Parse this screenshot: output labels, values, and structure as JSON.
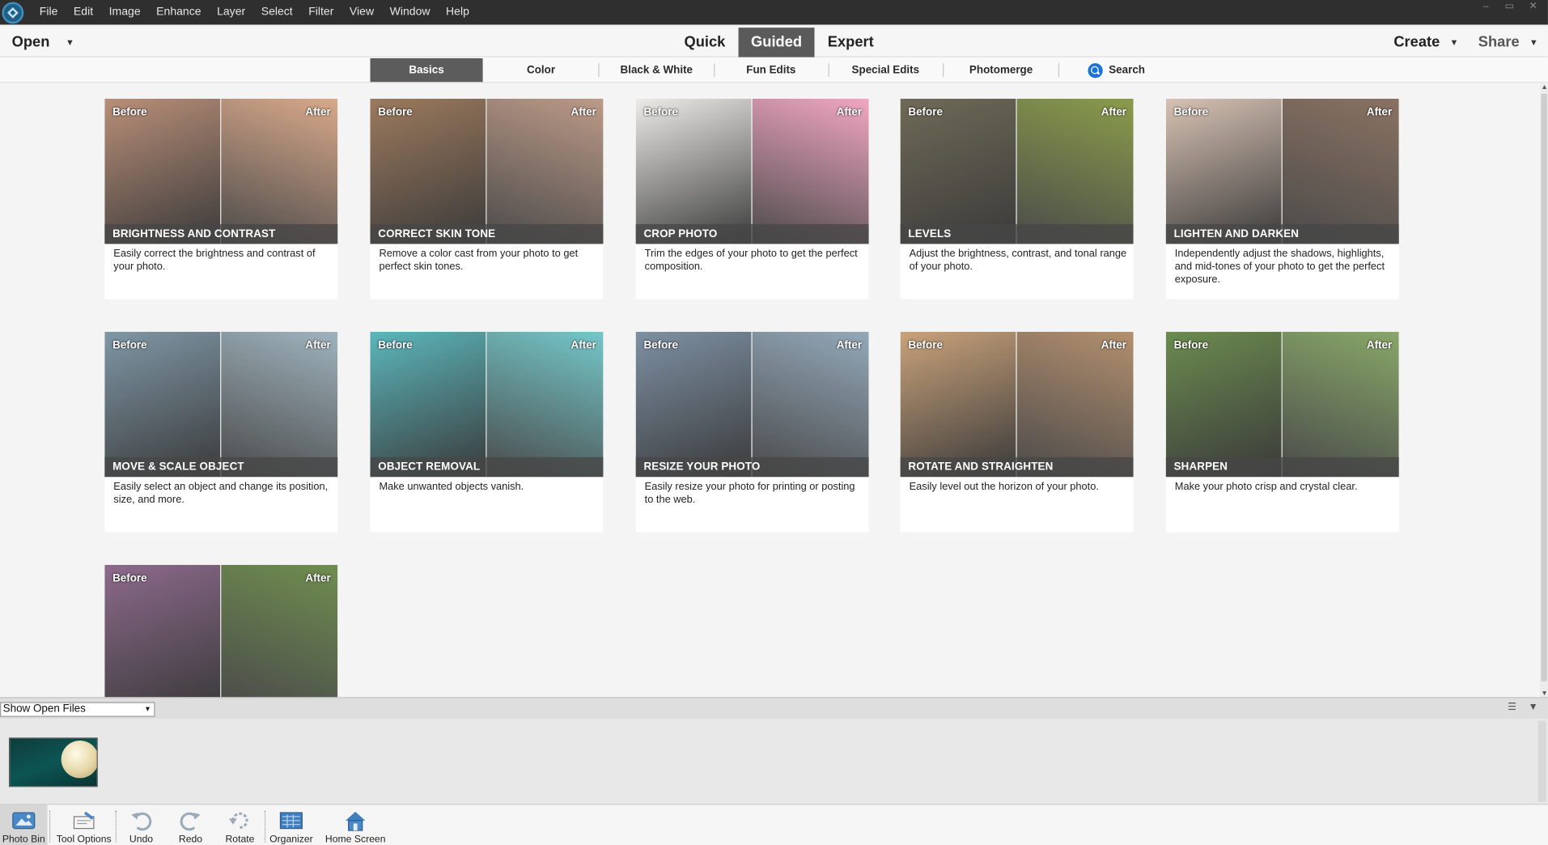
{
  "menubar": {
    "items": [
      "File",
      "Edit",
      "Image",
      "Enhance",
      "Layer",
      "Select",
      "Filter",
      "View",
      "Window",
      "Help"
    ],
    "window_controls": [
      "–",
      "▭",
      "✕"
    ]
  },
  "modebar": {
    "open_label": "Open",
    "modes": [
      "Quick",
      "Guided",
      "Expert"
    ],
    "active_mode": "Guided",
    "create_label": "Create",
    "share_label": "Share"
  },
  "categories": {
    "tabs": [
      "Basics",
      "Color",
      "Black & White",
      "Fun Edits",
      "Special Edits",
      "Photomerge"
    ],
    "active": "Basics",
    "search_label": "Search"
  },
  "cards": [
    {
      "title": "BRIGHTNESS AND CONTRAST",
      "desc": "Easily correct the brightness and contrast of your photo.",
      "before": "Before",
      "after": "After",
      "colors": [
        "#b98f78",
        "#d9a98a"
      ]
    },
    {
      "title": "CORRECT SKIN TONE",
      "desc": "Remove a color cast from your photo to get perfect skin tones.",
      "before": "Before",
      "after": "After",
      "colors": [
        "#9c7a5d",
        "#bc9a87"
      ]
    },
    {
      "title": "CROP PHOTO",
      "desc": "Trim the edges of your photo to get the perfect composition.",
      "before": "Before",
      "after": "After",
      "colors": [
        "#ecebe8",
        "#f2a6c2"
      ]
    },
    {
      "title": "LEVELS",
      "desc": "Adjust the brightness, contrast, and tonal range of your photo.",
      "before": "Before",
      "after": "After",
      "colors": [
        "#6f6a57",
        "#8a9c4a"
      ]
    },
    {
      "title": "LIGHTEN AND DARKEN",
      "desc": "Independently adjust the shadows, highlights, and mid-tones of your photo to get the perfect exposure.",
      "before": "Before",
      "after": "After",
      "colors": [
        "#d7c2b3",
        "#8a7262"
      ]
    },
    {
      "title": "MOVE & SCALE OBJECT",
      "desc": "Easily select an object and change its position, size, and more.",
      "before": "Before",
      "after": "After",
      "colors": [
        "#7f97a6",
        "#9fb3bd"
      ]
    },
    {
      "title": "OBJECT REMOVAL",
      "desc": "Make unwanted objects vanish.",
      "before": "Before",
      "after": "After",
      "colors": [
        "#5bb6bb",
        "#74c7c9"
      ]
    },
    {
      "title": "RESIZE YOUR PHOTO",
      "desc": "Easily resize your photo for printing or posting to the web.",
      "before": "Before",
      "after": "After",
      "colors": [
        "#7d90a3",
        "#93a8b9"
      ]
    },
    {
      "title": "ROTATE AND STRAIGHTEN",
      "desc": "Easily level out the horizon of your photo.",
      "before": "Before",
      "after": "After",
      "colors": [
        "#c9a27a",
        "#b38f6e"
      ]
    },
    {
      "title": "SHARPEN",
      "desc": "Make your photo crisp and crystal clear.",
      "before": "Before",
      "after": "After",
      "colors": [
        "#6b8b4f",
        "#88a768"
      ]
    },
    {
      "title": "",
      "desc": "",
      "before": "Before",
      "after": "After",
      "colors": [
        "#8d6a8c",
        "#6f8d4f"
      ]
    }
  ],
  "photobin": {
    "select_value": "Show Open Files"
  },
  "toolbar": {
    "tools": [
      "Photo Bin",
      "Tool Options",
      "Undo",
      "Redo",
      "Rotate",
      "Organizer",
      "Home Screen"
    ]
  }
}
